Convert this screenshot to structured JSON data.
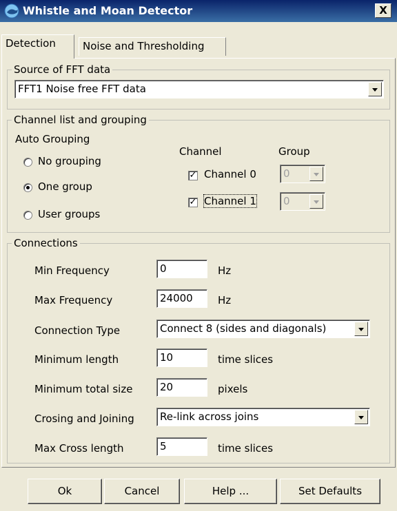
{
  "window": {
    "title": "Whistle and Moan Detector",
    "close_label": "X"
  },
  "tabs": [
    {
      "label": "Detection",
      "active": true
    },
    {
      "label": "Noise and Thresholding",
      "active": false
    }
  ],
  "source": {
    "legend": "Source of FFT data",
    "value": "FFT1 Noise free FFT data"
  },
  "channels": {
    "legend": "Channel list and grouping",
    "auto_grouping_label": "Auto Grouping",
    "options": [
      {
        "label": "No grouping",
        "checked": false
      },
      {
        "label": "One group",
        "checked": true
      },
      {
        "label": "User groups",
        "checked": false
      }
    ],
    "channel_header": "Channel",
    "group_header": "Group",
    "list": [
      {
        "label": "Channel 0",
        "checked": true,
        "group": "0"
      },
      {
        "label": "Channel 1",
        "checked": true,
        "group": "0"
      }
    ]
  },
  "connections": {
    "legend": "Connections",
    "min_freq": {
      "label": "Min Frequency",
      "value": "0",
      "unit": "Hz"
    },
    "max_freq": {
      "label": "Max Frequency",
      "value": "24000",
      "unit": "Hz"
    },
    "connection_type": {
      "label": "Connection Type",
      "value": "Connect 8 (sides and diagonals)"
    },
    "min_length": {
      "label": "Minimum length",
      "value": "10",
      "unit": "time slices"
    },
    "min_total_size": {
      "label": "Minimum total size",
      "value": "20",
      "unit": "pixels"
    },
    "crossing": {
      "label": "Crosing and Joining",
      "value": "Re-link across joins"
    },
    "max_cross": {
      "label": "Max Cross length",
      "value": "5",
      "unit": "time slices"
    }
  },
  "buttons": {
    "ok": "Ok",
    "cancel": "Cancel",
    "help": "Help ...",
    "defaults": "Set Defaults"
  },
  "colors": {
    "title_bar": "#0A246A",
    "dialog_bg": "#ECE9D8"
  }
}
